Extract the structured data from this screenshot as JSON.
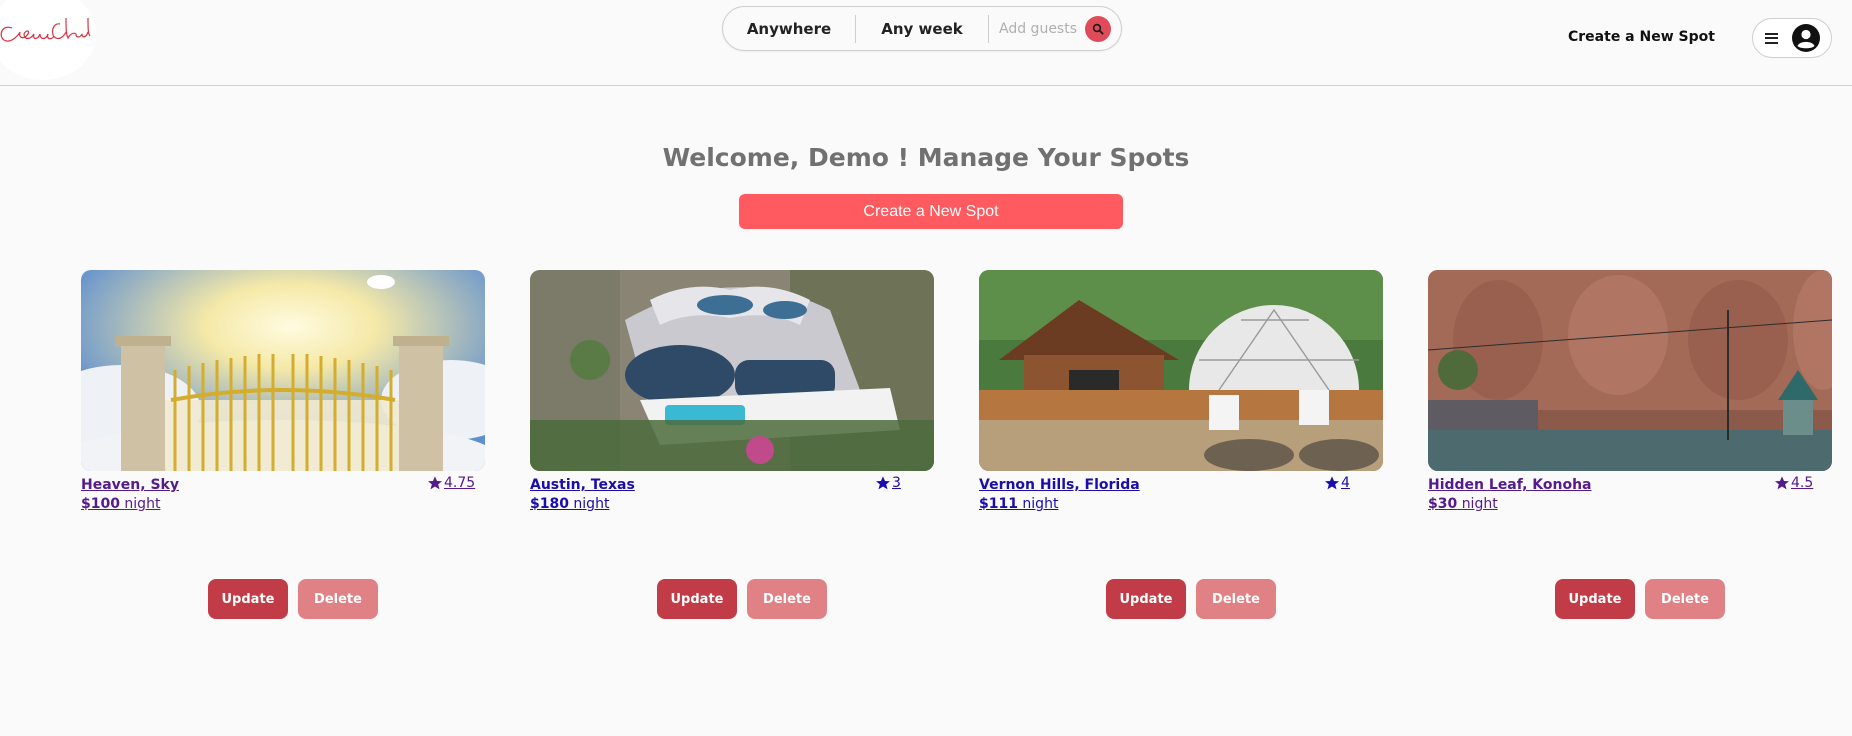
{
  "header": {
    "logo_text": "Casa Cloud",
    "search": {
      "anywhere_label": "Anywhere",
      "week_label": "Any week",
      "guests_placeholder": "Add guests",
      "search_icon": "search-icon"
    },
    "create_link": "Create a New Spot",
    "profile": {
      "menu_icon": "hamburger-icon",
      "avatar_icon": "user-avatar-icon"
    }
  },
  "main": {
    "welcome": "Welcome, Demo ! Manage Your Spots",
    "create_button": "Create a New Spot",
    "update_label": "Update",
    "delete_label": "Delete",
    "price_suffix": "night",
    "star_icon": "star-icon",
    "colors": {
      "accent": "#ff5a5f",
      "update_button": "#c13c47",
      "delete_button": "#e08185",
      "visited_link": "#551a8b",
      "unvisited_link": "#1a0dab"
    },
    "spots": [
      {
        "location": "Heaven, Sky",
        "rating": "4.75",
        "price": "$100",
        "visited": true
      },
      {
        "location": "Austin, Texas",
        "rating": "3",
        "price": "$180",
        "visited": false
      },
      {
        "location": "Vernon Hills, Florida",
        "rating": "4",
        "price": "$111",
        "visited": false
      },
      {
        "location": "Hidden Leaf, Konoha",
        "rating": "4.5",
        "price": "$30",
        "visited": true
      }
    ]
  }
}
